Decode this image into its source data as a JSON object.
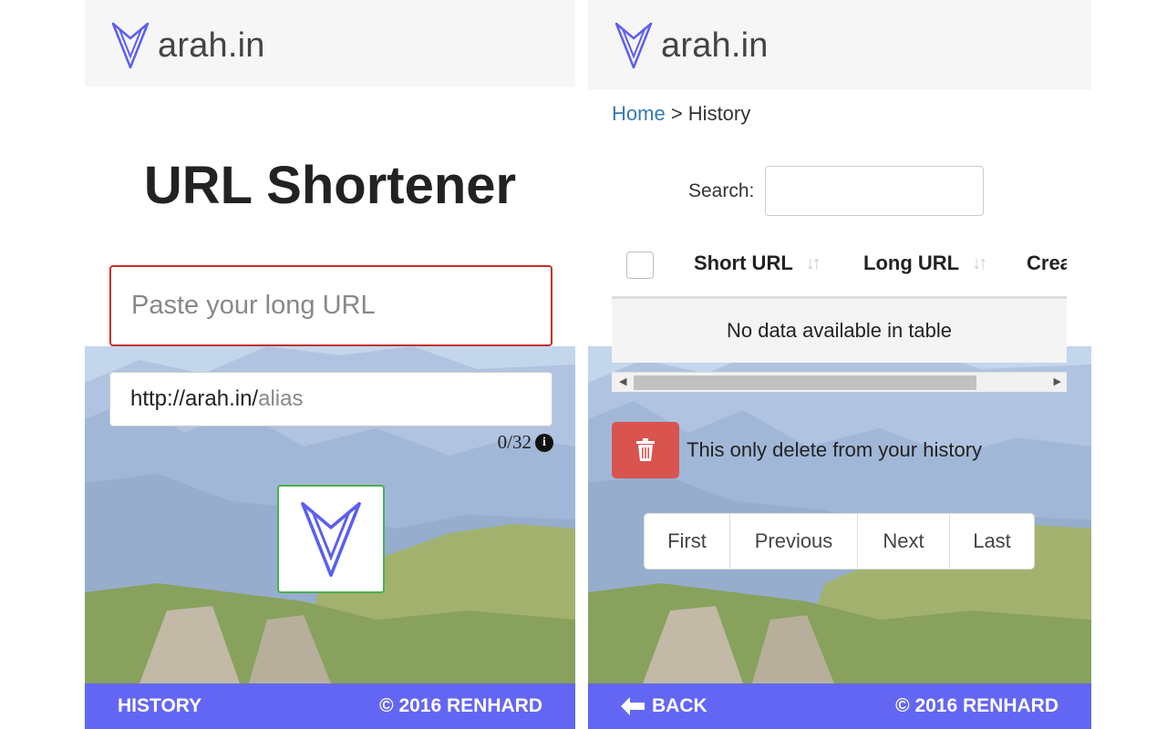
{
  "brand": {
    "name": "arah.in",
    "accent": "#6366f3"
  },
  "shortener": {
    "title": "URL Shortener",
    "long_url_placeholder": "Paste your long URL",
    "alias_prefix": "http://arah.in/",
    "alias_hint": "alias",
    "counter": "0/32",
    "info_icon_glyph": "i",
    "submit_icon": "logo-icon"
  },
  "footer_left": {
    "link": "HISTORY",
    "copyright": "© 2016 RENHARD"
  },
  "history": {
    "breadcrumb_home": "Home",
    "breadcrumb_separator": ">",
    "breadcrumb_current": "History",
    "search_label": "Search:",
    "search_value": "",
    "columns": [
      "Short URL",
      "Long URL",
      "Crea"
    ],
    "empty_message": "No data available in table",
    "delete_note": "This only delete from your history",
    "pagination": [
      "First",
      "Previous",
      "Next",
      "Last"
    ]
  },
  "footer_right": {
    "back_icon": "arrow-left-icon",
    "back_label": "BACK",
    "copyright": "© 2016 RENHARD"
  },
  "colors": {
    "danger": "#d9534f",
    "success_border": "#4caf50",
    "link": "#337ab7"
  }
}
